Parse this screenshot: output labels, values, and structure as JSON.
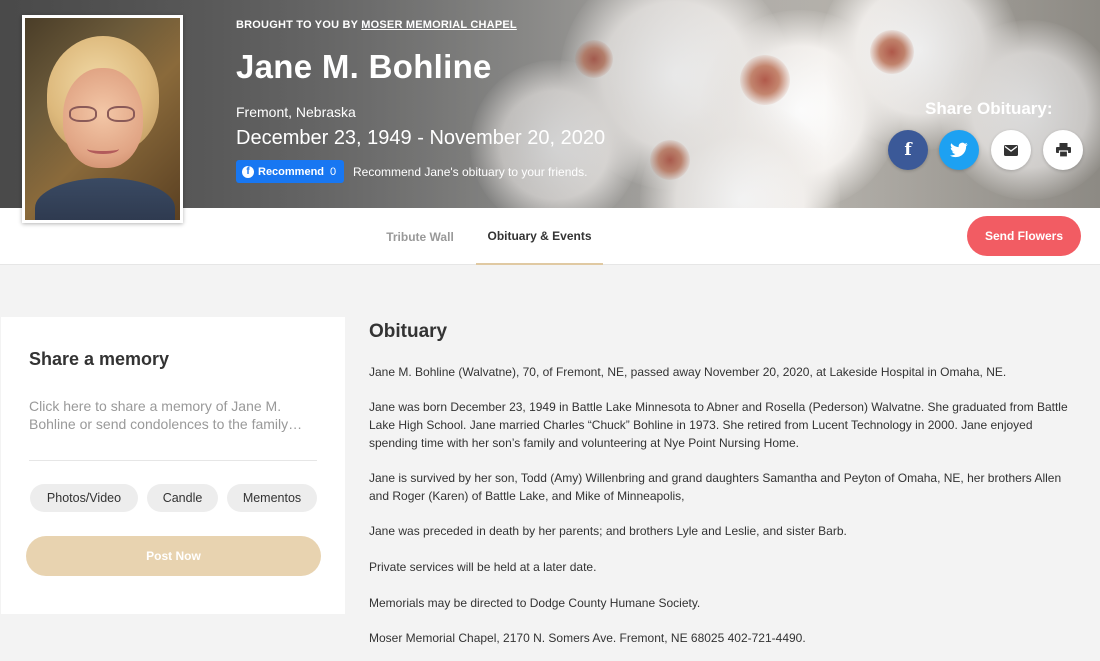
{
  "header": {
    "brought_prefix": "BROUGHT TO YOU BY",
    "brought_link": "MOSER MEMORIAL CHAPEL",
    "name": "Jane M. Bohline",
    "location": "Fremont, Nebraska",
    "dates": "December 23, 1949 - November 20, 2020",
    "recommend_label": "Recommend",
    "recommend_count": "0",
    "recommend_text": "Recommend Jane's obituary to your friends."
  },
  "share": {
    "title": "Share Obituary:",
    "facebook_icon": "f",
    "twitter_icon": "🐦",
    "email_icon": "✉",
    "print_icon": "🖶"
  },
  "nav": {
    "tabs": [
      {
        "label": "Tribute Wall",
        "active": false
      },
      {
        "label": "Obituary & Events",
        "active": true
      }
    ],
    "send_flowers": "Send Flowers"
  },
  "memory": {
    "title": "Share a memory",
    "placeholder": "Click here to share a memory of Jane M. Bohline or send condolences to the family…",
    "chips": [
      "Photos/Video",
      "Candle",
      "Mementos"
    ],
    "post_label": "Post Now"
  },
  "obituary": {
    "heading": "Obituary",
    "paragraphs": [
      "Jane M. Bohline (Walvatne), 70, of Fremont, NE, passed away November 20, 2020, at Lakeside Hospital in Omaha, NE.",
      "Jane was born December 23, 1949 in Battle Lake Minnesota to Abner and Rosella (Pederson) Walvatne. She graduated from Battle Lake High School. Jane married Charles “Chuck” Bohline in 1973. She retired from Lucent Technology in 2000. Jane enjoyed spending time with her son’s family and volunteering at Nye Point Nursing Home.",
      "Jane is survived by her son, Todd (Amy) Willenbring and grand daughters Samantha and Peyton of Omaha, NE, her brothers Allen and Roger (Karen) of Battle Lake, and Mike of Minneapolis,",
      "Jane was preceded in death by her parents; and brothers Lyle and Leslie, and sister Barb.",
      "Private services will be held at a later date.",
      "Memorials may be directed to Dodge County Humane Society.",
      "Moser Memorial Chapel, 2170 N. Somers Ave. Fremont, NE 68025 402-721-4490."
    ]
  },
  "colors": {
    "accent_flowers": "#f25c63",
    "post_button": "#e8d3b0",
    "facebook": "#3b5998",
    "twitter": "#1da1f2",
    "fb_recommend": "#1877f2"
  }
}
